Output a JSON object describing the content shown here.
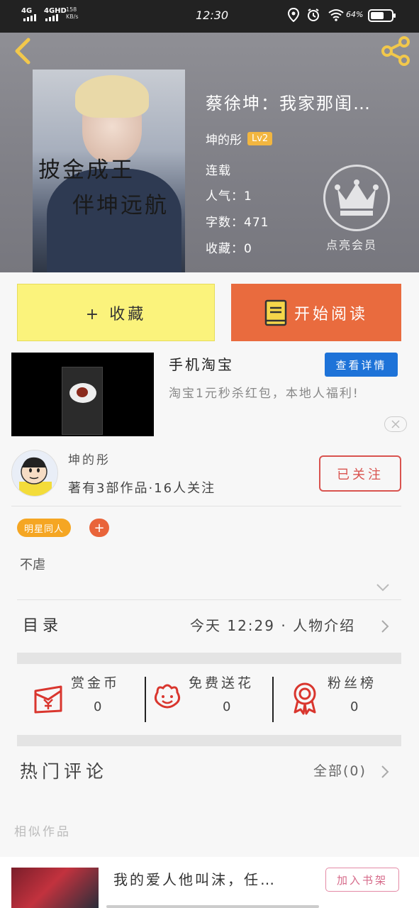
{
  "status_bar": {
    "signal1": "4G",
    "signal2": "4GHD",
    "speed_value": "158",
    "speed_unit": "KB/s",
    "time": "12:30",
    "battery_text": "64%",
    "battery_level": 0.64
  },
  "header": {
    "back_icon": "chevron-left-icon",
    "share_icon": "share-icon",
    "book_title": "蔡徐坤：我家那闺…",
    "cover_line1": "披金成王",
    "cover_line2": "伴坤远航",
    "author": "坤的彤",
    "level": "Lv2",
    "status": "连载",
    "popularity": "人气：1",
    "word_count": "字数：471",
    "collections": "收藏：0",
    "vip_label": "点亮会员",
    "vip_icon": "crown-icon"
  },
  "actions": {
    "collect_label": "+ 收藏",
    "read_label": "开始阅读",
    "read_icon": "book-icon"
  },
  "ad": {
    "title": "手机淘宝",
    "detail_label": "查看详情",
    "description": "淘宝1元秒杀红包，本地人福利!",
    "close_icon": "close-icon"
  },
  "author_section": {
    "name": "坤的彤",
    "stats": "著有3部作品·16人关注",
    "follow_label": "已关注"
  },
  "tags": {
    "tag1": "明星同人",
    "add_label": "+"
  },
  "intro": {
    "text": "不虐"
  },
  "catalog": {
    "label": "目录",
    "info": "今天  12:29 · 人物介绍"
  },
  "stats": [
    {
      "label": "赏金币",
      "value": "0",
      "icon": "reward-envelope-icon"
    },
    {
      "label": "免费送花",
      "value": "0",
      "icon": "flower-icon"
    },
    {
      "label": "粉丝榜",
      "value": "0",
      "icon": "medal-icon"
    }
  ],
  "hot_comments": {
    "label": "热门评论",
    "all_label": "全部(0)"
  },
  "similar": {
    "label": "相似作品",
    "item_title": "我的爱人他叫沫，任…",
    "add_label": "加入书架"
  },
  "colors": {
    "accent_orange": "#e96b3e",
    "collect_yellow": "#fbf37c",
    "tag_orange": "#f5a623",
    "follow_red": "#d9534f",
    "ad_blue": "#1e73d8"
  }
}
